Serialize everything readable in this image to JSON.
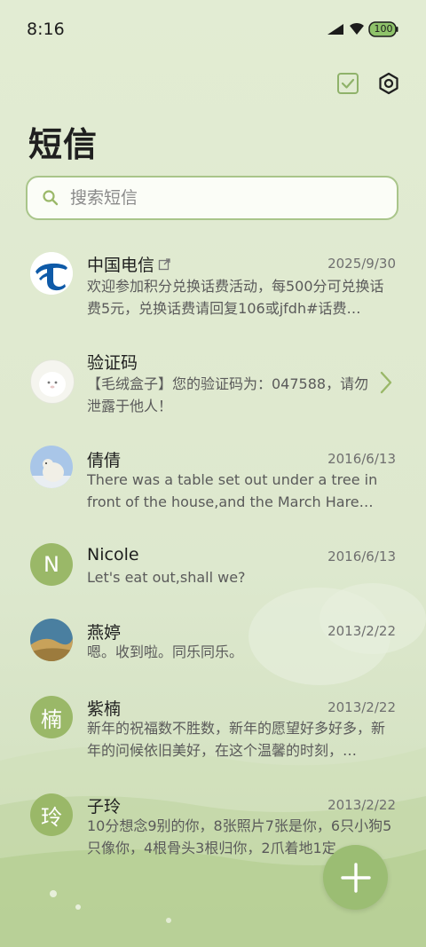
{
  "status_bar": {
    "time": "8:16",
    "battery": "100"
  },
  "header": {
    "title": "短信"
  },
  "search": {
    "placeholder": "搜索短信"
  },
  "conversations": [
    {
      "name": "中国电信",
      "date": "2025/9/30",
      "preview": "欢迎参加积分兑换话费活动，每500分可兑换话费5元，兑换话费请回复106或jfdh#话费…"
    },
    {
      "name": "验证码",
      "date": "",
      "preview": "【毛绒盒子】您的验证码为：047588，请勿泄露于他人！"
    },
    {
      "name": "倩倩",
      "date": "2016/6/13",
      "preview": "There was a table set out under a tree in front of the house,and the March Hare an…"
    },
    {
      "name": "Nicole",
      "date": "2016/6/13",
      "preview": "Let's eat out,shall we?",
      "avatar_letter": "N"
    },
    {
      "name": "燕婷",
      "date": "2013/2/22",
      "preview": "嗯。收到啦。同乐同乐。"
    },
    {
      "name": "紫楠",
      "date": "2013/2/22",
      "preview": "新年的祝福数不胜数，新年的愿望好多好多，新年的问候依旧美好，在这个温馨的时刻，…",
      "avatar_letter": "楠"
    },
    {
      "name": "子玲",
      "date": "2013/2/22",
      "preview": "10分想念9别的你，8张照片7张是你，6只小狗5只像你，4根骨头3根归你，2爪着地1定…",
      "avatar_letter": "玲"
    }
  ],
  "colors": {
    "accent": "#9bbd73",
    "search_border": "#a9c58a",
    "background": "#e0ead0"
  },
  "icons": [
    "signal-icon",
    "wifi-icon",
    "battery-icon",
    "checklist-icon",
    "settings-icon",
    "search-icon",
    "external-link-icon",
    "chevron-right-icon",
    "compose-plus-icon"
  ]
}
